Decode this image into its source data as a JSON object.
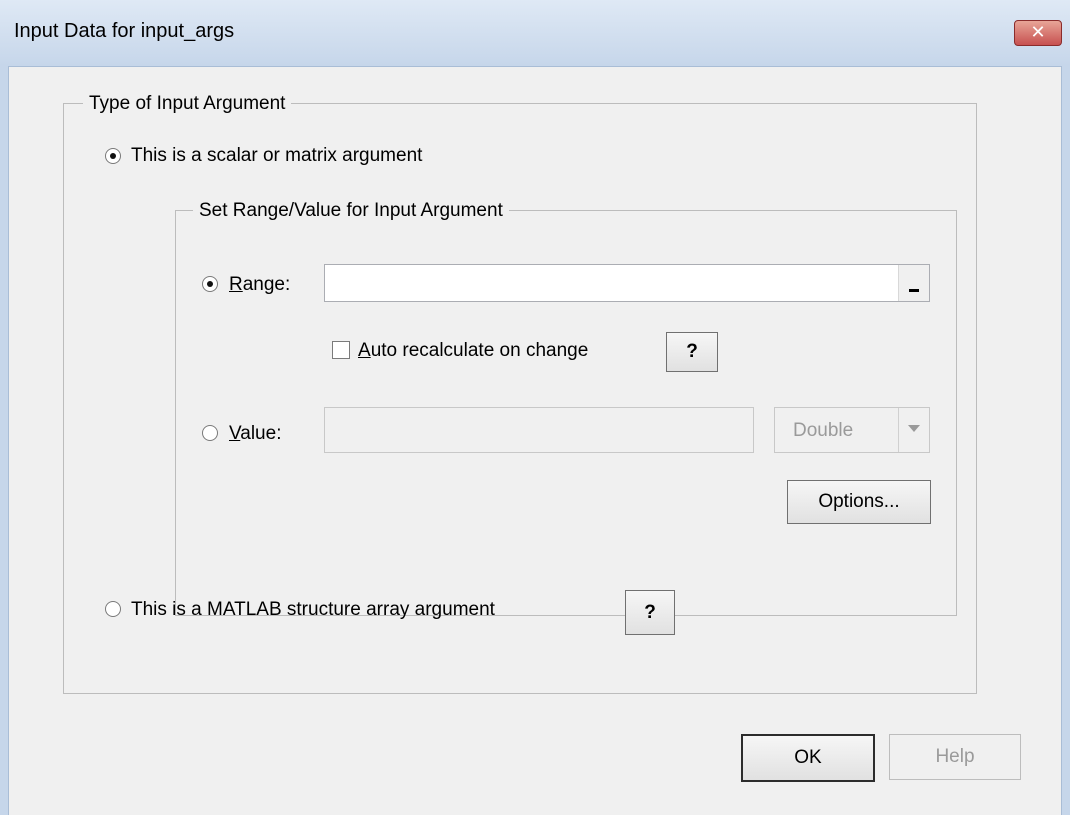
{
  "window": {
    "title": "Input Data for input_args",
    "close_label": "✕"
  },
  "type_group": {
    "label": "Type of Input Argument",
    "scalar_option": {
      "label": "This is a scalar or matrix argument",
      "selected": true
    },
    "struct_option": {
      "label": "This is a MATLAB structure array argument",
      "selected": false
    },
    "struct_help_label": "?"
  },
  "range_group": {
    "label": "Set Range/Value for Input Argument",
    "range_option": {
      "accel": "R",
      "rest": "ange:",
      "selected": true
    },
    "range_input": {
      "value": ""
    },
    "range_picker_icon": "range-picker-icon",
    "auto_recalc": {
      "accel": "A",
      "rest": "uto recalculate on change",
      "checked": false
    },
    "auto_recalc_help_label": "?",
    "value_option": {
      "accel": "V",
      "rest": "alue:",
      "selected": false
    },
    "value_input": {
      "value": ""
    },
    "type_select": {
      "selected": "Double"
    },
    "options_label": "Options..."
  },
  "footer": {
    "ok_label": "OK",
    "help_label": "Help"
  }
}
